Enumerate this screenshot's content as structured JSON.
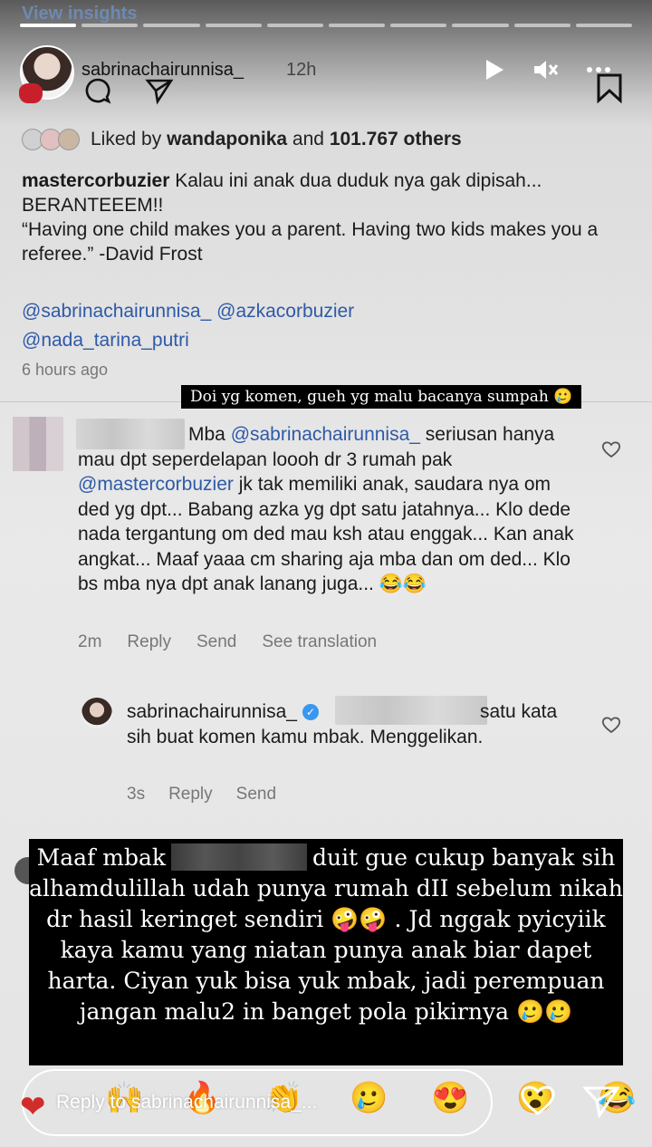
{
  "story": {
    "insights_label": "View insights",
    "progress": {
      "done": 1,
      "total": 10
    },
    "username": "sabrinachairunnisa_",
    "time": "12h"
  },
  "post": {
    "liked_prefix": "Liked by ",
    "liked_user": "wandaponika",
    "liked_mid": " and ",
    "liked_count": "101.767 others",
    "caption_user": "mastercorbuzier",
    "caption_text": " Kalau ini anak dua duduk nya gak dipisah... BERANTEEEM!!",
    "quote": "“Having one child makes you a parent. Having two kids makes you a referee.” -David Frost",
    "tag1": "@sabrinachairunnisa_",
    "tag2": "@azkacorbuzier",
    "tag3": "@nada_tarina_putri",
    "ago": "6 hours ago"
  },
  "sticker_top": "Doi yg komen, gueh yg malu bacanya sumpah 🥲",
  "comment": {
    "lead": "Mba ",
    "mention1": "@sabrinachairunnisa_",
    "text1": " seriusan hanya mau dpt seperdelapan loooh dr 3 rumah pak ",
    "mention2": "@mastercorbuzier",
    "text2": " jk tak memiliki anak, saudara nya om ded yg dpt... Babang azka yg dpt satu jatahnya... Klo dede nada tergantung om ded mau ksh atau enggak... Kan anak angkat... Maaf yaaa cm sharing aja mba dan om ded... Klo bs mba nya dpt anak lanang juga... 😂😂",
    "time": "2m",
    "reply": "Reply",
    "send": "Send",
    "translate": "See translation"
  },
  "reply": {
    "username": "sabrinachairunnisa_",
    "verified": "✓",
    "text": "satu kata sih buat komen kamu mbak. Menggelikan.",
    "time": "3s",
    "reply": "Reply",
    "send": "Send"
  },
  "sticker_big": {
    "part1": "Maaf mbak",
    "part2": "duit gue cukup banyak sih alhamdulillah udah punya rumah dII sebelum nikah dr hasil keringet sendiri 🤪🤪 . Jd nggak pyicyiik kaya kamu yang niatan punya anak biar dapet harta. Ciyan yuk bisa yuk mbak, jadi perempuan jangan malu2 in banget pola pikirnya 🥲🥲"
  },
  "reply_bar": {
    "placeholder": "Reply to sabrinachairunnisa_...",
    "emojis": [
      "🙌",
      "🔥",
      "👏",
      "🥲",
      "😍",
      "😮",
      "😂"
    ]
  },
  "icons": {
    "header": [
      "play-icon",
      "mute-icon",
      "more-icon"
    ],
    "post": [
      "comment-icon",
      "share-icon",
      "bookmark-icon"
    ],
    "bar": [
      "heart-icon",
      "send-icon"
    ]
  }
}
